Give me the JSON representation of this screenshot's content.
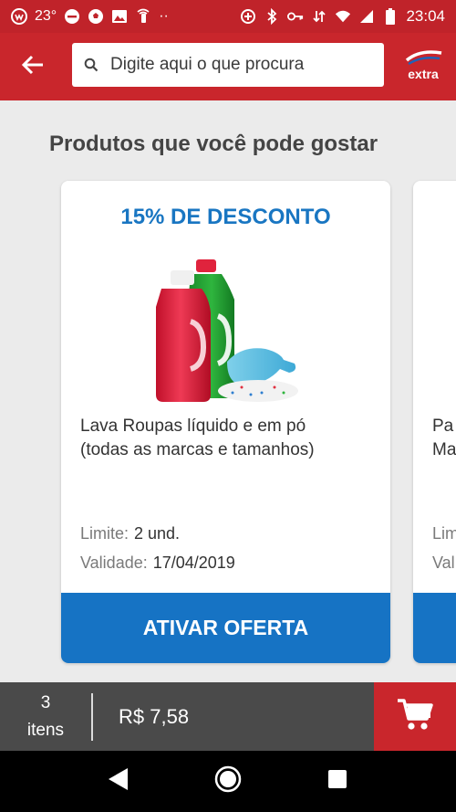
{
  "status_bar": {
    "temperature": "23°",
    "dots": "··",
    "time": "23:04"
  },
  "header": {
    "search_placeholder": "Digite aqui o que procura",
    "logo_text": "extra"
  },
  "section": {
    "title": "Produtos que você pode gostar"
  },
  "offer_card": {
    "discount": "15% DE DESCONTO",
    "description_line1": "Lava Roupas líquido e em pó",
    "description_line2": "(todas as marcas e tamanhos)",
    "limit_label": "Limite:",
    "limit_value": "2 und.",
    "validity_label": "Validade:",
    "validity_value": "17/04/2019",
    "button_label": "ATIVAR OFERTA"
  },
  "next_card_peek": {
    "description_line1": "Pa",
    "description_line2": "Ma",
    "limit_label": "Lim",
    "validity_label": "Val"
  },
  "cart": {
    "count": "3",
    "count_label": "itens",
    "total": "R$ 7,58"
  },
  "colors": {
    "brand_red": "#c9262c",
    "accent_blue": "#1673c4",
    "cart_bar": "#4a4a4a"
  }
}
